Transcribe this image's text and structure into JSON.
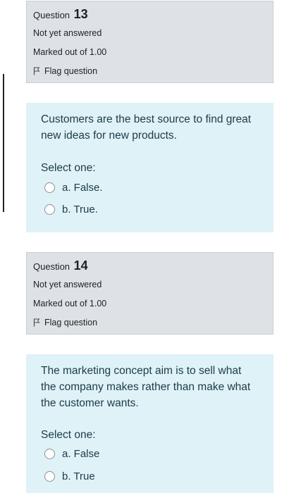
{
  "questions": [
    {
      "label": "Question",
      "number": "13",
      "status": "Not yet answered",
      "marks": "Marked out of 1.00",
      "flag_label": "Flag question",
      "text": "Customers are the best source to find great new ideas for new products.",
      "prompt": "Select one:",
      "options": [
        "a. False.",
        "b. True."
      ]
    },
    {
      "label": "Question",
      "number": "14",
      "status": "Not yet answered",
      "marks": "Marked out of 1.00",
      "flag_label": "Flag question",
      "text": "The marketing concept aim is to sell what the company makes rather than make what the customer wants.",
      "prompt": "Select one:",
      "options": [
        "a. False",
        "b. True"
      ]
    }
  ],
  "colors": {
    "info_bg": "#dee2e6",
    "content_bg": "#def2f8",
    "content_text": "#1f3a45"
  },
  "icons": {
    "flag": "flag-icon",
    "radio": "radio-unchecked"
  }
}
